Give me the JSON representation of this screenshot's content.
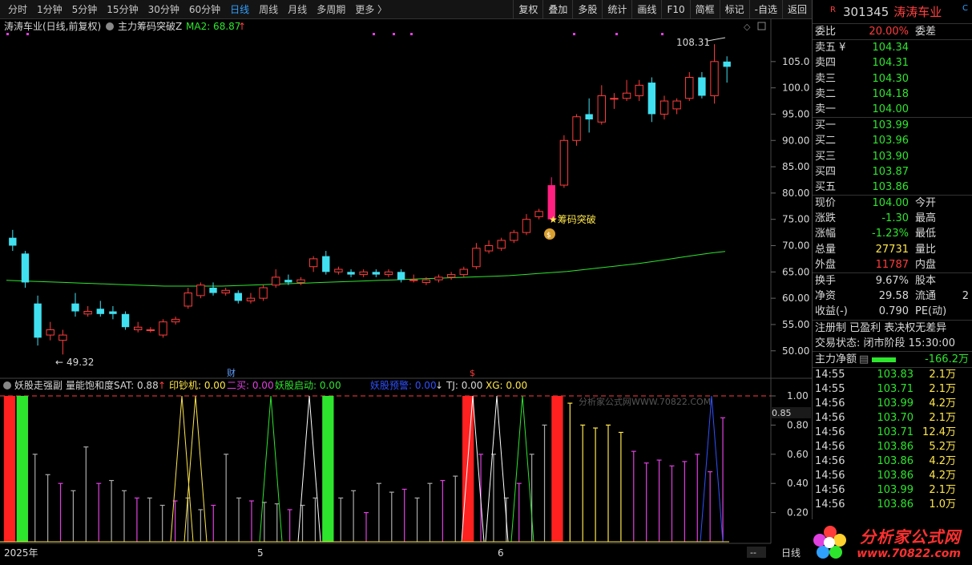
{
  "toolbar": {
    "periods": [
      "分时",
      "1分钟",
      "5分钟",
      "15分钟",
      "30分钟",
      "60分钟",
      "日线",
      "周线",
      "月线",
      "多周期",
      "更多 〉"
    ],
    "active_period": "日线",
    "buttons": [
      "复权",
      "叠加",
      "多股",
      "统计",
      "画线",
      "F10",
      "简框",
      "标记",
      "-自选",
      "返回"
    ]
  },
  "chart_header": {
    "title": "涛涛车业(日线,前复权)",
    "indicator": "主力筹码突破Z",
    "ma_label": "MA2: 68.87",
    "ma_arrow": "↑",
    "high_label": "108.31",
    "low_label": "49.32",
    "signal_label": "★筹码突破",
    "fin_marker": "财",
    "dollar_marker": "$"
  },
  "sub_header": {
    "name": "妖股走强副",
    "sat": "量能饱和度SAT: 0.88",
    "sat_arrow": "↑",
    "yinchaoji": "印钞机: 0.00",
    "ermai": "二买: 0.00",
    "qidong": "妖股启动: 0.00",
    "yujing": "妖股预警: 0.00",
    "yujing_arrow": "↓",
    "tj": "TJ: 0.00",
    "xg": "XG: 0.00",
    "watermark": "分析家公式网WWW.70822.COM",
    "current_val": "0.85"
  },
  "y_axis_main": [
    "105.0",
    "100.0",
    "95.00",
    "90.00",
    "85.00",
    "80.00",
    "75.00",
    "70.00",
    "65.00",
    "60.00",
    "55.00",
    "50.00"
  ],
  "y_axis_sub": [
    "1.00",
    "0.80",
    "0.60",
    "0.40",
    "0.20"
  ],
  "x_axis": [
    "2025年",
    "5",
    "6"
  ],
  "x_axis_btn": "日线",
  "x_axis_dash": "--",
  "chart_data": {
    "type": "candlestick",
    "ylim": [
      46,
      110
    ],
    "ma_values": [
      63.4,
      63.3,
      63.2,
      63.1,
      63.0,
      62.9,
      62.8,
      62.7,
      62.6,
      62.5,
      62.4,
      62.3,
      62.3,
      62.3,
      62.3,
      62.3,
      62.4,
      62.5,
      62.6,
      62.7,
      62.8,
      62.9,
      63.0,
      63.1,
      63.2,
      63.3,
      63.4,
      63.5,
      63.6,
      63.7,
      63.8,
      63.9,
      64.0,
      64.1,
      64.2,
      64.3,
      64.5,
      64.7,
      64.9,
      65.1,
      65.4,
      65.7,
      66.0,
      66.3,
      66.6,
      67.0,
      67.4,
      67.8,
      68.2,
      68.6,
      68.9
    ],
    "candles": [
      {
        "o": 71.5,
        "c": 70.0,
        "h": 73.0,
        "l": 69.0
      },
      {
        "o": 68.5,
        "c": 63.0,
        "h": 69.0,
        "l": 62.0
      },
      {
        "o": 59.0,
        "c": 52.5,
        "h": 60.5,
        "l": 51.0
      },
      {
        "o": 53.0,
        "c": 54.0,
        "h": 55.5,
        "l": 52.0
      },
      {
        "o": 52.0,
        "c": 53.0,
        "h": 54.0,
        "l": 49.3
      },
      {
        "o": 59.0,
        "c": 57.5,
        "h": 61.0,
        "l": 56.5
      },
      {
        "o": 57.0,
        "c": 57.5,
        "h": 58.5,
        "l": 56.5
      },
      {
        "o": 58.0,
        "c": 57.0,
        "h": 59.5,
        "l": 56.5
      },
      {
        "o": 57.5,
        "c": 57.0,
        "h": 58.5,
        "l": 56.0
      },
      {
        "o": 57.0,
        "c": 54.5,
        "h": 57.5,
        "l": 54.0
      },
      {
        "o": 54.0,
        "c": 54.5,
        "h": 55.5,
        "l": 53.5
      },
      {
        "o": 54.0,
        "c": 54.0,
        "h": 54.5,
        "l": 53.5
      },
      {
        "o": 53.0,
        "c": 55.5,
        "h": 56.0,
        "l": 52.5
      },
      {
        "o": 55.5,
        "c": 56.0,
        "h": 56.5,
        "l": 55.0
      },
      {
        "o": 58.5,
        "c": 61.0,
        "h": 62.0,
        "l": 58.0
      },
      {
        "o": 60.5,
        "c": 62.5,
        "h": 63.0,
        "l": 60.0
      },
      {
        "o": 62.0,
        "c": 61.0,
        "h": 63.0,
        "l": 60.5
      },
      {
        "o": 61.0,
        "c": 61.5,
        "h": 62.0,
        "l": 60.5
      },
      {
        "o": 61.0,
        "c": 59.5,
        "h": 61.5,
        "l": 59.0
      },
      {
        "o": 59.5,
        "c": 60.0,
        "h": 61.0,
        "l": 59.0
      },
      {
        "o": 60.0,
        "c": 62.0,
        "h": 62.5,
        "l": 59.5
      },
      {
        "o": 62.5,
        "c": 64.0,
        "h": 65.5,
        "l": 62.0
      },
      {
        "o": 63.5,
        "c": 63.0,
        "h": 64.5,
        "l": 62.5
      },
      {
        "o": 63.0,
        "c": 63.5,
        "h": 64.0,
        "l": 62.5
      },
      {
        "o": 66.0,
        "c": 67.5,
        "h": 68.0,
        "l": 65.0
      },
      {
        "o": 68.0,
        "c": 65.0,
        "h": 69.0,
        "l": 64.5
      },
      {
        "o": 65.0,
        "c": 65.5,
        "h": 66.0,
        "l": 64.5
      },
      {
        "o": 65.0,
        "c": 64.5,
        "h": 65.5,
        "l": 64.0
      },
      {
        "o": 64.5,
        "c": 65.0,
        "h": 65.5,
        "l": 64.0
      },
      {
        "o": 65.0,
        "c": 64.5,
        "h": 65.5,
        "l": 64.0
      },
      {
        "o": 64.5,
        "c": 65.0,
        "h": 65.5,
        "l": 64.0
      },
      {
        "o": 65.0,
        "c": 63.5,
        "h": 65.5,
        "l": 63.0
      },
      {
        "o": 63.5,
        "c": 63.5,
        "h": 64.5,
        "l": 63.0
      },
      {
        "o": 63.0,
        "c": 63.5,
        "h": 64.0,
        "l": 62.5
      },
      {
        "o": 63.5,
        "c": 64.0,
        "h": 64.5,
        "l": 63.0
      },
      {
        "o": 64.0,
        "c": 64.5,
        "h": 65.0,
        "l": 63.5
      },
      {
        "o": 64.5,
        "c": 65.5,
        "h": 66.0,
        "l": 64.0
      },
      {
        "o": 66.0,
        "c": 69.5,
        "h": 70.5,
        "l": 65.5
      },
      {
        "o": 69.0,
        "c": 70.0,
        "h": 71.0,
        "l": 68.5
      },
      {
        "o": 69.5,
        "c": 71.0,
        "h": 71.5,
        "l": 69.0
      },
      {
        "o": 71.0,
        "c": 72.5,
        "h": 73.0,
        "l": 70.5
      },
      {
        "o": 72.5,
        "c": 75.0,
        "h": 76.0,
        "l": 72.0
      },
      {
        "o": 75.5,
        "c": 76.5,
        "h": 77.0,
        "l": 75.0
      },
      {
        "o": 75.0,
        "c": 81.5,
        "h": 83.0,
        "l": 74.5
      },
      {
        "o": 81.5,
        "c": 90.0,
        "h": 91.0,
        "l": 81.0
      },
      {
        "o": 90.0,
        "c": 94.5,
        "h": 95.0,
        "l": 89.0
      },
      {
        "o": 95.0,
        "c": 94.0,
        "h": 98.0,
        "l": 91.5
      },
      {
        "o": 93.5,
        "c": 98.5,
        "h": 100.5,
        "l": 93.0
      },
      {
        "o": 98.0,
        "c": 98.0,
        "h": 99.0,
        "l": 96.0
      },
      {
        "o": 98.0,
        "c": 99.0,
        "h": 101.5,
        "l": 97.5
      },
      {
        "o": 98.5,
        "c": 100.5,
        "h": 101.5,
        "l": 97.5
      },
      {
        "o": 101.0,
        "c": 95.0,
        "h": 102.0,
        "l": 93.5
      },
      {
        "o": 95.0,
        "c": 97.5,
        "h": 98.5,
        "l": 94.0
      },
      {
        "o": 96.0,
        "c": 97.5,
        "h": 98.0,
        "l": 95.0
      },
      {
        "o": 98.0,
        "c": 102.0,
        "h": 103.0,
        "l": 97.5
      },
      {
        "o": 102.0,
        "c": 98.5,
        "h": 103.0,
        "l": 98.0
      },
      {
        "o": 98.5,
        "c": 105.0,
        "h": 108.3,
        "l": 97.0
      },
      {
        "o": 105.0,
        "c": 104.0,
        "h": 106.0,
        "l": 101.0
      }
    ],
    "sub_bars": [
      1.0,
      1.0,
      0.6,
      0.46,
      0.4,
      0.35,
      0.65,
      0.4,
      0.42,
      0.35,
      0.3,
      0.3,
      0.25,
      0.28,
      0.3,
      0.22,
      0.25,
      0.6,
      0.3,
      0.28,
      0.27,
      0.26,
      0.22,
      0.25,
      0.3,
      1.0,
      0.3,
      0.35,
      0.2,
      0.4,
      0.34,
      0.36,
      0.3,
      0.4,
      0.42,
      0.45,
      1.0,
      0.6,
      0.6,
      0.3,
      0.4,
      0.6,
      0.8,
      1.0,
      0.95,
      0.8,
      0.78,
      0.8,
      0.75,
      0.62,
      0.54,
      0.56,
      0.52,
      0.55,
      0.6,
      0.48,
      0.85
    ]
  },
  "quote": {
    "r_mark": "R",
    "code": "301345",
    "name": "涛涛车业",
    "c_mark": "C",
    "webi_label": "委比",
    "webi_val": "20.00%",
    "wecha_label": "委差",
    "sells": [
      {
        "label": "卖五",
        "mark": "¥",
        "price": "104.34"
      },
      {
        "label": "卖四",
        "mark": "",
        "price": "104.31"
      },
      {
        "label": "卖三",
        "mark": "",
        "price": "104.30"
      },
      {
        "label": "卖二",
        "mark": "",
        "price": "104.18"
      },
      {
        "label": "卖一",
        "mark": "",
        "price": "104.00"
      }
    ],
    "buys": [
      {
        "label": "买一",
        "price": "103.99"
      },
      {
        "label": "买二",
        "price": "103.96"
      },
      {
        "label": "买三",
        "price": "103.90"
      },
      {
        "label": "买四",
        "price": "103.87"
      },
      {
        "label": "买五",
        "price": "103.86"
      }
    ],
    "stats": [
      {
        "l1": "现价",
        "v1": "104.00",
        "c1": "green",
        "l2": "今开",
        "v2": "",
        "c2": "white"
      },
      {
        "l1": "涨跌",
        "v1": "-1.30",
        "c1": "green",
        "l2": "最高",
        "v2": "",
        "c2": "white"
      },
      {
        "l1": "涨幅",
        "v1": "-1.23%",
        "c1": "green",
        "l2": "最低",
        "v2": "",
        "c2": "white"
      },
      {
        "l1": "总量",
        "v1": "27731",
        "c1": "yellow",
        "l2": "量比",
        "v2": "",
        "c2": "white"
      },
      {
        "l1": "外盘",
        "v1": "11787",
        "c1": "red",
        "l2": "内盘",
        "v2": "",
        "c2": "white"
      }
    ],
    "stats2": [
      {
        "l1": "换手",
        "v1": "9.67%",
        "c1": "white",
        "l2": "股本",
        "v2": "",
        "c2": "white"
      },
      {
        "l1": "净资",
        "v1": "29.58",
        "c1": "white",
        "l2": "流通",
        "v2": "2",
        "c2": "white"
      },
      {
        "l1": "收益(-)",
        "v1": "0.790",
        "c1": "white",
        "l2": "PE(动)",
        "v2": "",
        "c2": "white"
      }
    ],
    "info1": "注册制  已盈利  表决权无差异",
    "info2": "交易状态: 闭市阶段 15:30:00",
    "zhuli_label": "主力净额",
    "zhuli_icon": "▤",
    "zhuli_val": "-166.2万",
    "trades": [
      {
        "t": "14:55",
        "p": "103.83",
        "v": "2.1万"
      },
      {
        "t": "14:55",
        "p": "103.71",
        "v": "2.1万"
      },
      {
        "t": "14:56",
        "p": "103.99",
        "v": "4.2万"
      },
      {
        "t": "14:56",
        "p": "103.70",
        "v": "2.1万"
      },
      {
        "t": "14:56",
        "p": "103.71",
        "v": "12.4万"
      },
      {
        "t": "14:56",
        "p": "103.86",
        "v": "5.2万"
      },
      {
        "t": "14:56",
        "p": "103.86",
        "v": "4.2万"
      },
      {
        "t": "14:56",
        "p": "103.86",
        "v": "4.2万"
      },
      {
        "t": "14:56",
        "p": "103.99",
        "v": "2.1万"
      },
      {
        "t": "14:56",
        "p": "103.86",
        "v": "1.0万"
      }
    ]
  },
  "watermark": {
    "line1": "分析家公式网",
    "line2": "www.70822.com"
  }
}
